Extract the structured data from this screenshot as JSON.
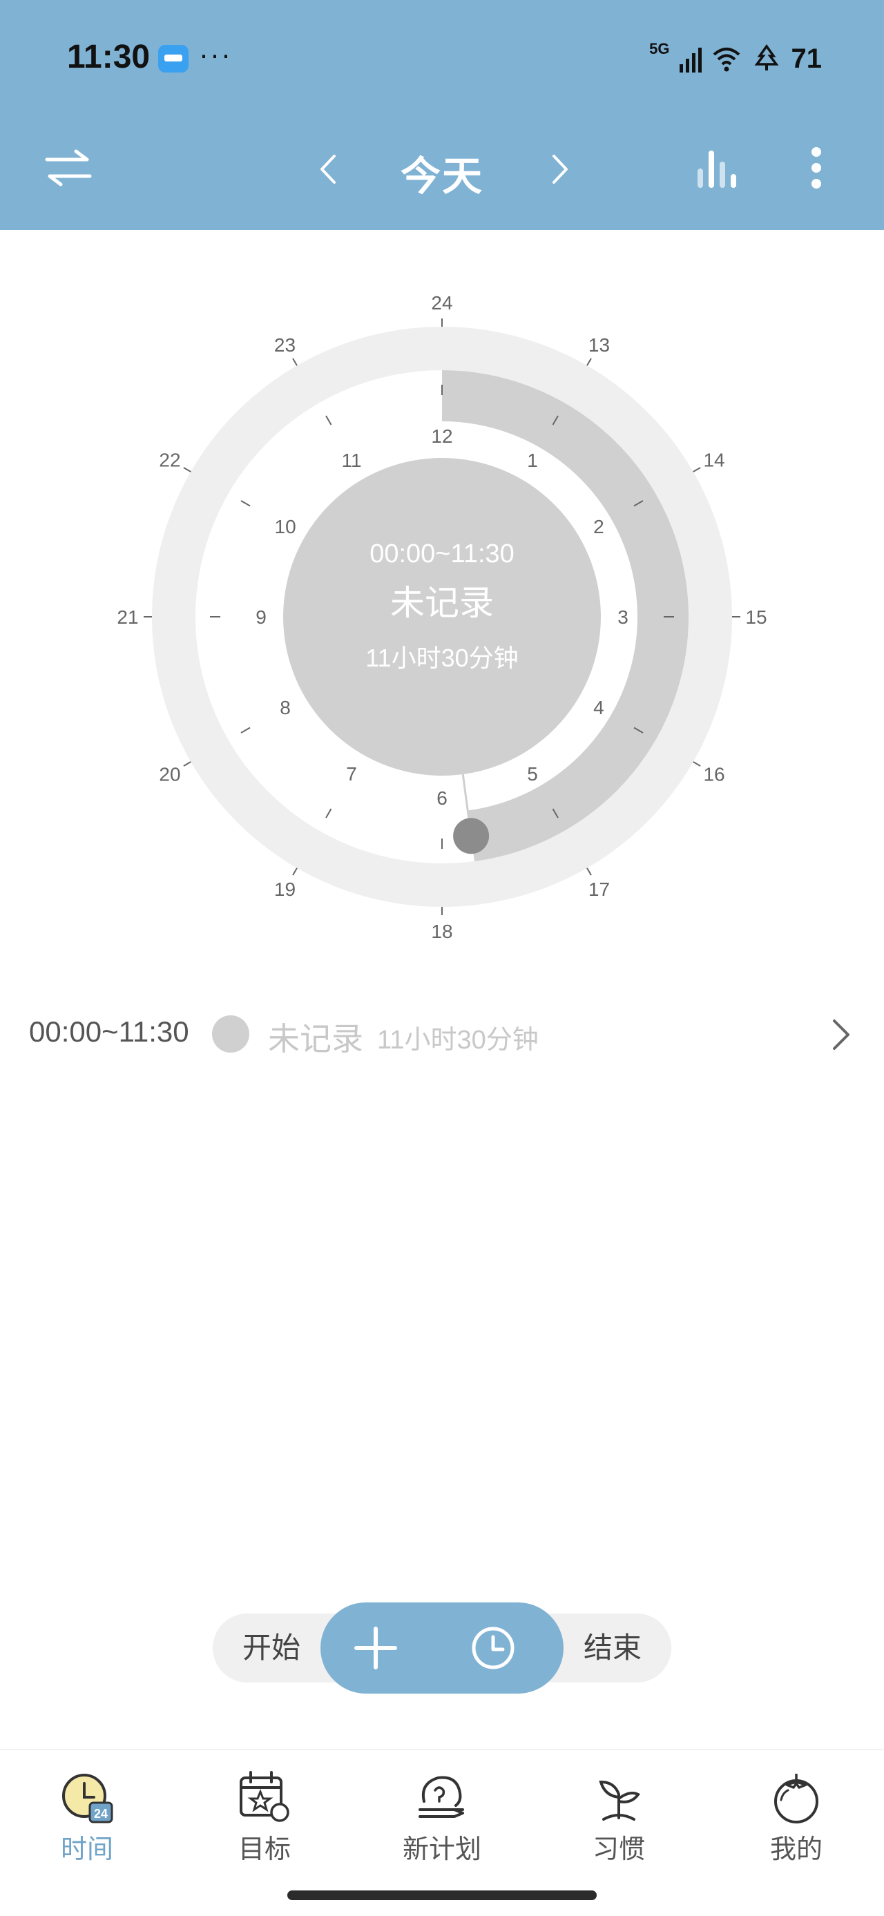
{
  "status_bar": {
    "time": "11:30",
    "more": "···",
    "network": "5G",
    "battery": "71",
    "icons": [
      "wallet-icon",
      "signal-icon",
      "wifi-icon",
      "tree-icon"
    ]
  },
  "header": {
    "title": "今天",
    "bg_color": "#80b2d4",
    "icons": [
      "switch-arrows-icon",
      "chevron-left-icon",
      "chevron-right-icon",
      "bar-chart-icon",
      "more-vertical-icon"
    ]
  },
  "clock": {
    "outer_ticks": [
      "24",
      "13",
      "14",
      "15",
      "16",
      "17",
      "18",
      "19",
      "20",
      "21",
      "22",
      "23"
    ],
    "inner_ticks": [
      "12",
      "1",
      "2",
      "3",
      "4",
      "5",
      "6",
      "7",
      "8",
      "9",
      "10",
      "11"
    ],
    "center_range": "00:00~11:30",
    "center_status": "未记录",
    "center_duration": "11小时30分钟",
    "elapsed_fraction": 0.479
  },
  "records": [
    {
      "time_range": "00:00~11:30",
      "name": "未记录",
      "duration": "11小时30分钟",
      "dot_color": "#d0d0d0"
    }
  ],
  "actions": {
    "start_label": "开始",
    "end_label": "结束",
    "accent": "#80b2d4"
  },
  "tabs": [
    {
      "label": "时间",
      "icon": "clock-24-icon",
      "active": true
    },
    {
      "label": "目标",
      "icon": "calendar-star-icon",
      "active": false
    },
    {
      "label": "新计划",
      "icon": "brain-plan-icon",
      "active": false
    },
    {
      "label": "习惯",
      "icon": "sprout-icon",
      "active": false
    },
    {
      "label": "我的",
      "icon": "tomato-icon",
      "active": false
    }
  ]
}
